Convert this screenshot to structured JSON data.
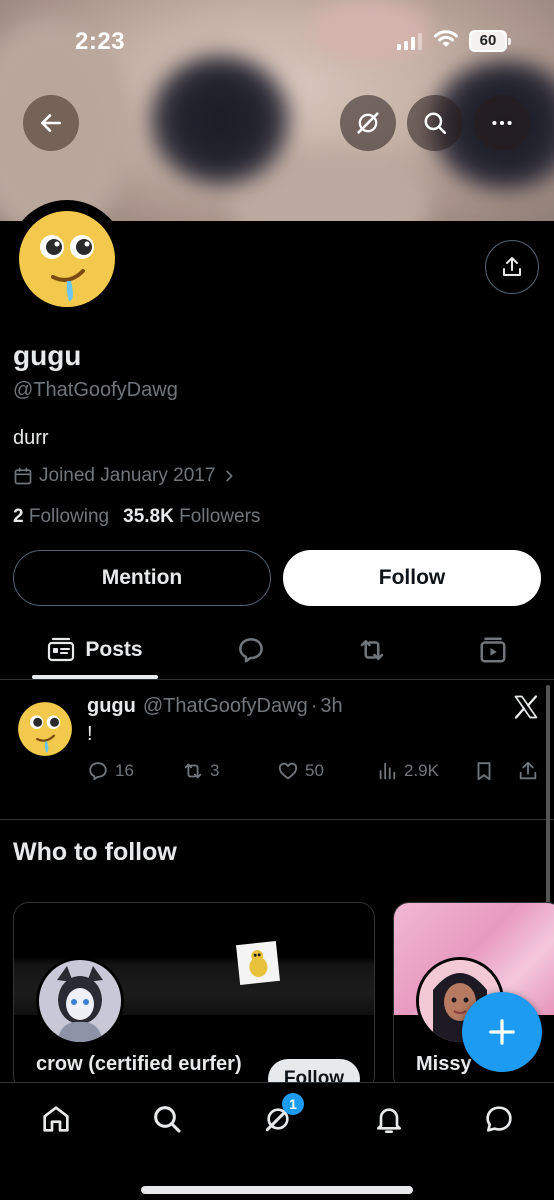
{
  "status_bar": {
    "time": "2:23",
    "battery": "60"
  },
  "profile": {
    "display_name": "gugu",
    "handle": "@ThatGoofyDawg",
    "bio": "durr",
    "joined": "Joined January 2017",
    "following_count": "2",
    "following_label": "Following",
    "followers_count": "35.8K",
    "followers_label": "Followers"
  },
  "actions": {
    "mention_label": "Mention",
    "follow_label": "Follow"
  },
  "tabs": {
    "posts_label": "Posts"
  },
  "tweet": {
    "name": "gugu",
    "handle": "@ThatGoofyDawg",
    "time": "3h",
    "separator": "·",
    "text": "!",
    "replies": "16",
    "reposts": "3",
    "likes": "50",
    "views": "2.9K"
  },
  "who_to_follow": {
    "title": "Who to follow",
    "cards": [
      {
        "name": "crow (certified eurfer)",
        "follow_label": "Follow"
      },
      {
        "name": "Missy"
      }
    ]
  },
  "bottom_nav": {
    "notification_badge": "1"
  },
  "colors": {
    "accent": "#1d9bf0",
    "background": "#000000",
    "muted": "#71767b",
    "text": "#e7e9ea"
  }
}
